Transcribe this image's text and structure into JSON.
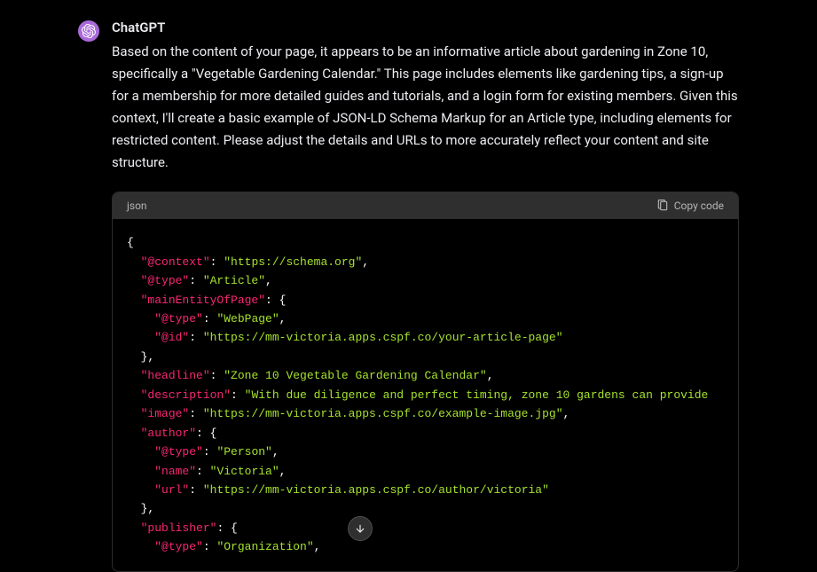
{
  "message": {
    "author": "ChatGPT",
    "text": "Based on the content of your page, it appears to be an informative article about gardening in Zone 10, specifically a \"Vegetable Gardening Calendar.\" This page includes elements like gardening tips, a sign-up for a membership for more detailed guides and tutorials, and a login form for existing members. Given this context, I'll create a basic example of JSON-LD Schema Markup for an Article type, including elements for restricted content. Please adjust the details and URLs to more accurately reflect your content and site structure."
  },
  "code": {
    "lang": "json",
    "copy_label": "Copy code",
    "lines": [
      {
        "indent": 0,
        "parts": [
          {
            "t": "punct",
            "v": "{"
          }
        ]
      },
      {
        "indent": 1,
        "parts": [
          {
            "t": "key",
            "v": "\"@context\""
          },
          {
            "t": "punct",
            "v": ": "
          },
          {
            "t": "string",
            "v": "\"https://schema.org\""
          },
          {
            "t": "punct",
            "v": ","
          }
        ]
      },
      {
        "indent": 1,
        "parts": [
          {
            "t": "key",
            "v": "\"@type\""
          },
          {
            "t": "punct",
            "v": ": "
          },
          {
            "t": "string",
            "v": "\"Article\""
          },
          {
            "t": "punct",
            "v": ","
          }
        ]
      },
      {
        "indent": 1,
        "parts": [
          {
            "t": "key",
            "v": "\"mainEntityOfPage\""
          },
          {
            "t": "punct",
            "v": ": {"
          }
        ]
      },
      {
        "indent": 2,
        "parts": [
          {
            "t": "key",
            "v": "\"@type\""
          },
          {
            "t": "punct",
            "v": ": "
          },
          {
            "t": "string",
            "v": "\"WebPage\""
          },
          {
            "t": "punct",
            "v": ","
          }
        ]
      },
      {
        "indent": 2,
        "parts": [
          {
            "t": "key",
            "v": "\"@id\""
          },
          {
            "t": "punct",
            "v": ": "
          },
          {
            "t": "string",
            "v": "\"https://mm-victoria.apps.cspf.co/your-article-page\""
          }
        ]
      },
      {
        "indent": 1,
        "parts": [
          {
            "t": "punct",
            "v": "},"
          }
        ]
      },
      {
        "indent": 1,
        "parts": [
          {
            "t": "key",
            "v": "\"headline\""
          },
          {
            "t": "punct",
            "v": ": "
          },
          {
            "t": "string",
            "v": "\"Zone 10 Vegetable Gardening Calendar\""
          },
          {
            "t": "punct",
            "v": ","
          }
        ]
      },
      {
        "indent": 1,
        "parts": [
          {
            "t": "key",
            "v": "\"description\""
          },
          {
            "t": "punct",
            "v": ": "
          },
          {
            "t": "string",
            "v": "\"With due diligence and perfect timing, zone 10 gardens can provide"
          }
        ]
      },
      {
        "indent": 1,
        "parts": [
          {
            "t": "key",
            "v": "\"image\""
          },
          {
            "t": "punct",
            "v": ": "
          },
          {
            "t": "string",
            "v": "\"https://mm-victoria.apps.cspf.co/example-image.jpg\""
          },
          {
            "t": "punct",
            "v": ","
          }
        ]
      },
      {
        "indent": 1,
        "parts": [
          {
            "t": "key",
            "v": "\"author\""
          },
          {
            "t": "punct",
            "v": ": {"
          }
        ]
      },
      {
        "indent": 2,
        "parts": [
          {
            "t": "key",
            "v": "\"@type\""
          },
          {
            "t": "punct",
            "v": ": "
          },
          {
            "t": "string",
            "v": "\"Person\""
          },
          {
            "t": "punct",
            "v": ","
          }
        ]
      },
      {
        "indent": 2,
        "parts": [
          {
            "t": "key",
            "v": "\"name\""
          },
          {
            "t": "punct",
            "v": ": "
          },
          {
            "t": "string",
            "v": "\"Victoria\""
          },
          {
            "t": "punct",
            "v": ","
          }
        ]
      },
      {
        "indent": 2,
        "parts": [
          {
            "t": "key",
            "v": "\"url\""
          },
          {
            "t": "punct",
            "v": ": "
          },
          {
            "t": "string",
            "v": "\"https://mm-victoria.apps.cspf.co/author/victoria\""
          }
        ]
      },
      {
        "indent": 1,
        "parts": [
          {
            "t": "punct",
            "v": "},"
          }
        ]
      },
      {
        "indent": 1,
        "parts": [
          {
            "t": "key",
            "v": "\"publisher\""
          },
          {
            "t": "punct",
            "v": ": {"
          }
        ]
      },
      {
        "indent": 2,
        "parts": [
          {
            "t": "key",
            "v": "\"@type\""
          },
          {
            "t": "punct",
            "v": ": "
          },
          {
            "t": "string",
            "v": "\"Organization\""
          },
          {
            "t": "punct",
            "v": ","
          }
        ]
      }
    ]
  }
}
